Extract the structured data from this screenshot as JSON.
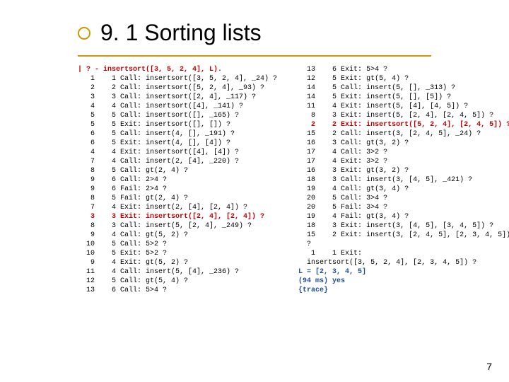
{
  "title": "9. 1 Sorting lists",
  "page_number": "7",
  "left_lines": [
    {
      "t": "| ? - insertsort([3, 5, 2, 4], L).",
      "c": "red"
    },
    {
      "t": "   1    1 Call: insertsort([3, 5, 2, 4], _24) ?"
    },
    {
      "t": "   2    2 Call: insertsort([5, 2, 4], _93) ?"
    },
    {
      "t": "   3    3 Call: insertsort([2, 4], _117) ?"
    },
    {
      "t": "   4    4 Call: insertsort([4], _141) ?"
    },
    {
      "t": "   5    5 Call: insertsort([], _165) ?"
    },
    {
      "t": "   5    5 Exit: insertsort([], []) ?"
    },
    {
      "t": "   6    5 Call: insert(4, [], _191) ?"
    },
    {
      "t": "   6    5 Exit: insert(4, [], [4]) ?"
    },
    {
      "t": "   4    4 Exit: insertsort([4], [4]) ?"
    },
    {
      "t": "   7    4 Call: insert(2, [4], _220) ?"
    },
    {
      "t": "   8    5 Call: gt(2, 4) ?"
    },
    {
      "t": "   9    6 Call: 2>4 ?"
    },
    {
      "t": "   9    6 Fail: 2>4 ?"
    },
    {
      "t": "   8    5 Fail: gt(2, 4) ?"
    },
    {
      "t": "   7    4 Exit: insert(2, [4], [2, 4]) ?"
    },
    {
      "t": "   3    3 Exit: insertsort([2, 4], [2, 4]) ?",
      "c": "red"
    },
    {
      "t": "   8    3 Call: insert(5, [2, 4], _249) ?"
    },
    {
      "t": "   9    4 Call: gt(5, 2) ?"
    },
    {
      "t": "  10    5 Call: 5>2 ?"
    },
    {
      "t": "  10    5 Exit: 5>2 ?"
    },
    {
      "t": "   9    4 Exit: gt(5, 2) ?"
    },
    {
      "t": "  11    4 Call: insert(5, [4], _236) ?"
    },
    {
      "t": "  12    5 Call: gt(5, 4) ?"
    },
    {
      "t": "  13    6 Call: 5>4 ?"
    }
  ],
  "right_lines": [
    {
      "t": "  13    6 Exit: 5>4 ?"
    },
    {
      "t": "  12    5 Exit: gt(5, 4) ?"
    },
    {
      "t": "  14    5 Call: insert(5, [], _313) ?"
    },
    {
      "t": "  14    5 Exit: insert(5, [], [5]) ?"
    },
    {
      "t": "  11    4 Exit: insert(5, [4], [4, 5]) ?"
    },
    {
      "t": "   8    3 Exit: insert(5, [2, 4], [2, 4, 5]) ?"
    },
    {
      "t": "   2    2 Exit: insertsort([5, 2, 4], [2, 4, 5]) ?",
      "c": "red"
    },
    {
      "t": "  15    2 Call: insert(3, [2, 4, 5], _24) ?"
    },
    {
      "t": "  16    3 Call: gt(3, 2) ?"
    },
    {
      "t": "  17    4 Call: 3>2 ?"
    },
    {
      "t": "  17    4 Exit: 3>2 ?"
    },
    {
      "t": "  16    3 Exit: gt(3, 2) ?"
    },
    {
      "t": "  18    3 Call: insert(3, [4, 5], _421) ?"
    },
    {
      "t": "  19    4 Call: gt(3, 4) ?"
    },
    {
      "t": "  20    5 Call: 3>4 ?"
    },
    {
      "t": "  20    5 Fail: 3>4 ?"
    },
    {
      "t": "  19    4 Fail: gt(3, 4) ?"
    },
    {
      "t": "  18    3 Exit: insert(3, [4, 5], [3, 4, 5]) ?"
    },
    {
      "t": "  15    2 Exit: insert(3, [2, 4, 5], [2, 3, 4, 5])"
    },
    {
      "t": "  ?"
    },
    {
      "t": "   1    1 Exit:"
    },
    {
      "t": "  insertsort([3, 5, 2, 4], [2, 3, 4, 5]) ?"
    },
    {
      "t": ""
    },
    {
      "t": "L = [2, 3, 4, 5]",
      "c": "blue"
    },
    {
      "t": ""
    },
    {
      "t": "(94 ms) yes",
      "c": "blue"
    },
    {
      "t": "{trace}",
      "c": "blue"
    }
  ]
}
